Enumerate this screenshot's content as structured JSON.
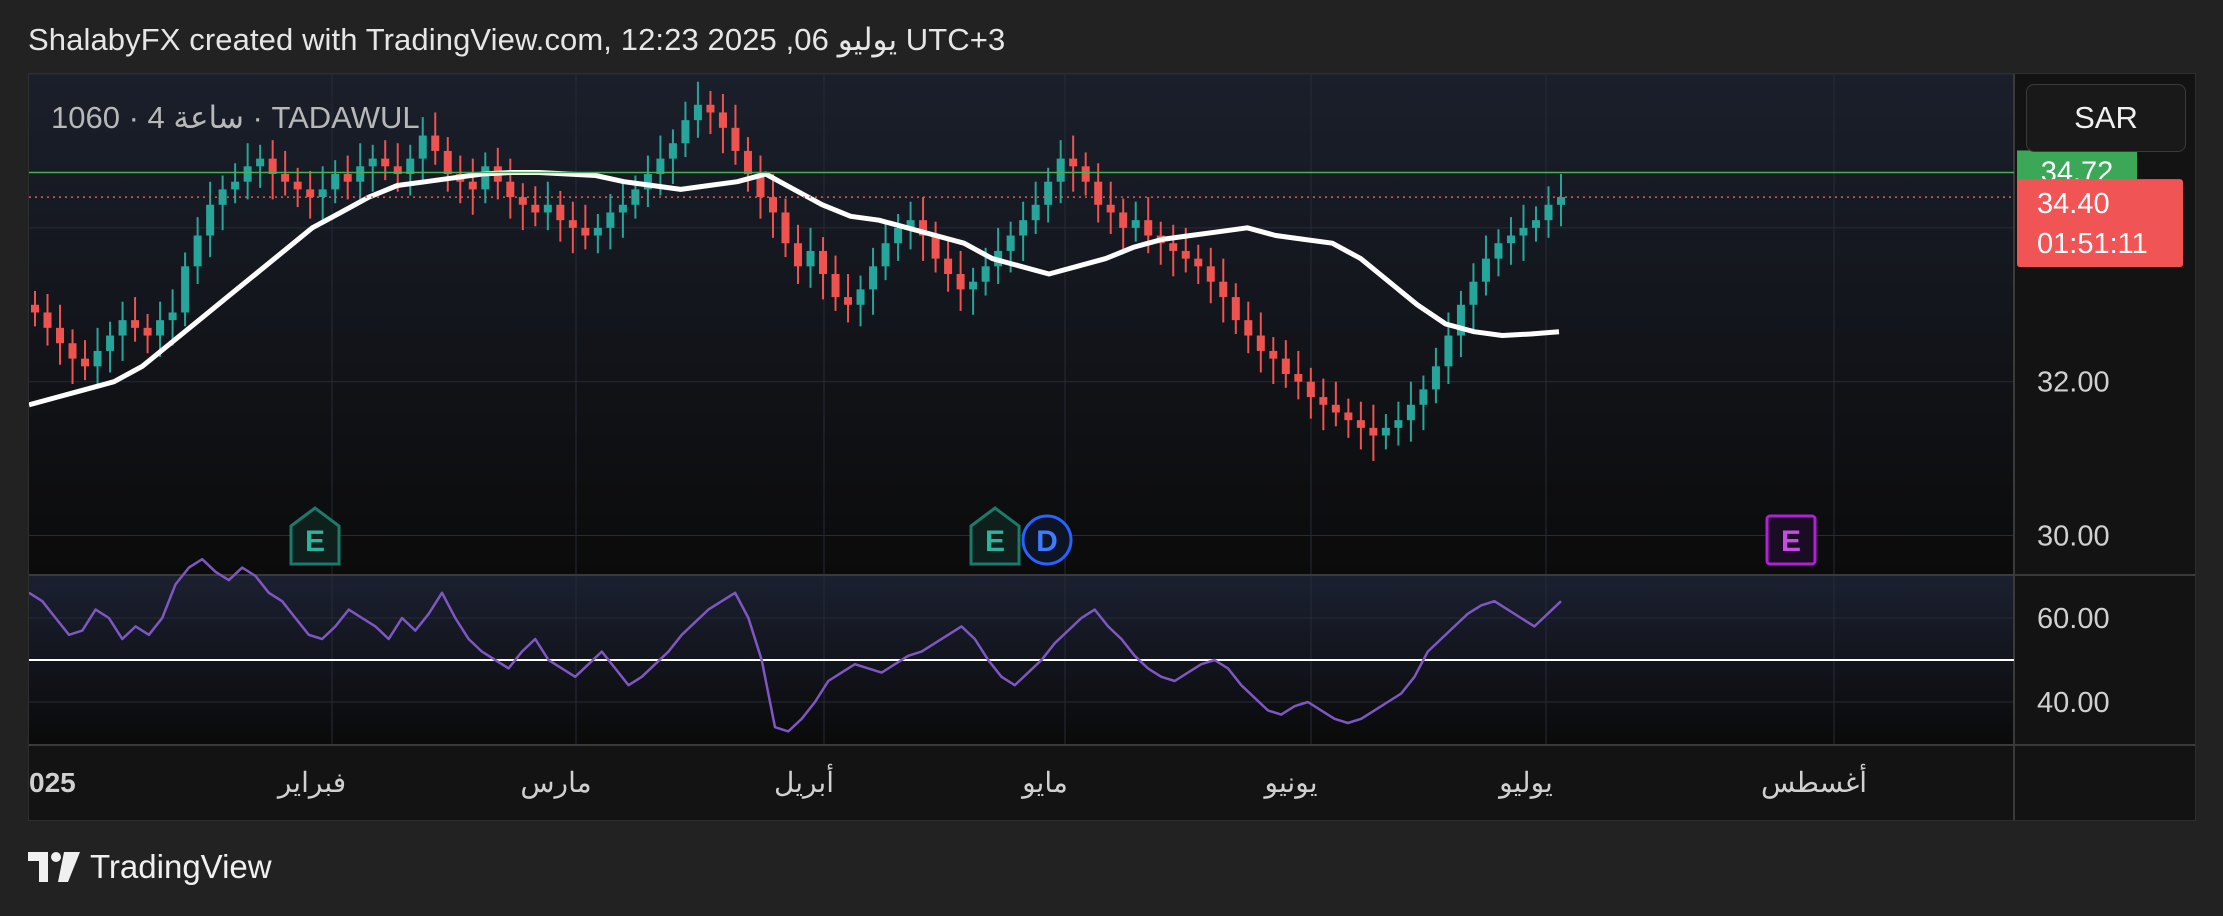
{
  "header": {
    "text": "ShalabyFX created with TradingView.com, 12:23 2025 ,06 يوليو UTC+3"
  },
  "symbol_label": "1060 · 4 ساعة · TADAWUL",
  "currency_button": "SAR",
  "brand": {
    "name": "TradingView"
  },
  "price_axis": {
    "ticks": [
      "32.00",
      "30.00"
    ],
    "high_label": "34.72",
    "last_label": "34.40",
    "countdown": "01:51:11"
  },
  "rsi_axis": {
    "ticks": [
      "60.00",
      "40.00"
    ]
  },
  "time_axis": {
    "labels": [
      "025",
      "فبراير",
      "مارس",
      "أبريل",
      "مايو",
      "يونيو",
      "يوليو",
      "أغسطس"
    ]
  },
  "events": [
    {
      "label": "E",
      "kind": "earnings-past"
    },
    {
      "label": "E",
      "kind": "earnings-past"
    },
    {
      "label": "D",
      "kind": "dividend"
    },
    {
      "label": "E",
      "kind": "earnings-upcoming"
    }
  ],
  "colors": {
    "up": "#26a69a",
    "down": "#ef5350",
    "ma": "#ffffff",
    "rsi": "#7e57c2",
    "high_line": "#4caf50",
    "last_line": "#ef5350",
    "background": "#131313",
    "earnings_past": "#1b7a6a",
    "dividend": "#2962ff",
    "earnings_upcoming": "#b31fd8"
  },
  "chart_data": [
    {
      "type": "candlestick",
      "title": "1060 · 4 ساعة · TADAWUL",
      "currency": "SAR",
      "ylim": [
        29.5,
        36.0
      ],
      "x_labels": [
        "025",
        "فبراير",
        "مارس",
        "أبريل",
        "مايو",
        "يونيو",
        "يوليو",
        "أغسطس"
      ],
      "closes": [
        32.9,
        32.7,
        32.5,
        32.3,
        32.2,
        32.4,
        32.6,
        32.8,
        32.7,
        32.6,
        32.8,
        32.9,
        33.5,
        33.9,
        34.3,
        34.5,
        34.6,
        34.8,
        34.9,
        34.7,
        34.6,
        34.5,
        34.4,
        34.5,
        34.7,
        34.6,
        34.8,
        34.9,
        34.8,
        34.7,
        34.9,
        35.2,
        35.0,
        34.7,
        34.6,
        34.5,
        34.8,
        34.6,
        34.4,
        34.3,
        34.2,
        34.3,
        34.1,
        34.0,
        33.9,
        34.0,
        34.2,
        34.3,
        34.5,
        34.7,
        34.9,
        35.1,
        35.4,
        35.6,
        35.5,
        35.3,
        35.0,
        34.7,
        34.4,
        34.2,
        33.8,
        33.5,
        33.7,
        33.4,
        33.1,
        33.0,
        33.2,
        33.5,
        33.8,
        34.0,
        34.1,
        33.9,
        33.6,
        33.4,
        33.2,
        33.3,
        33.5,
        33.7,
        33.9,
        34.1,
        34.3,
        34.6,
        34.9,
        34.8,
        34.6,
        34.3,
        34.2,
        34.0,
        34.1,
        33.9,
        33.8,
        33.7,
        33.6,
        33.5,
        33.3,
        33.1,
        32.8,
        32.6,
        32.4,
        32.3,
        32.1,
        32.0,
        31.8,
        31.7,
        31.6,
        31.5,
        31.4,
        31.3,
        31.4,
        31.5,
        31.7,
        31.9,
        32.2,
        32.6,
        33.0,
        33.3,
        33.6,
        33.8,
        33.9,
        34.0,
        34.1,
        34.3,
        34.4
      ],
      "moving_average": [
        31.7,
        31.8,
        31.9,
        32.0,
        32.2,
        32.5,
        32.8,
        33.1,
        33.4,
        33.7,
        34.0,
        34.2,
        34.4,
        34.55,
        34.6,
        34.65,
        34.7,
        34.72,
        34.72,
        34.7,
        34.68,
        34.6,
        34.55,
        34.5,
        34.55,
        34.6,
        34.7,
        34.5,
        34.3,
        34.15,
        34.1,
        34.0,
        33.9,
        33.8,
        33.6,
        33.5,
        33.4,
        33.5,
        33.6,
        33.75,
        33.85,
        33.9,
        33.95,
        34.0,
        33.9,
        33.85,
        33.8,
        33.6,
        33.3,
        33.0,
        32.75,
        32.65,
        32.6,
        32.62,
        32.65
      ],
      "high_price": 34.72,
      "last_price": 34.4
    },
    {
      "type": "line",
      "title": "RSI",
      "ylim": [
        30,
        70
      ],
      "level": 50,
      "values": [
        66,
        64,
        60,
        56,
        57,
        62,
        60,
        55,
        58,
        56,
        60,
        68,
        72,
        74,
        71,
        69,
        72,
        70,
        66,
        64,
        60,
        56,
        55,
        58,
        62,
        60,
        58,
        55,
        60,
        57,
        61,
        66,
        60,
        55,
        52,
        50,
        48,
        52,
        55,
        50,
        48,
        46,
        49,
        52,
        48,
        44,
        46,
        49,
        52,
        56,
        59,
        62,
        64,
        66,
        60,
        50,
        34,
        33,
        36,
        40,
        45,
        47,
        49,
        48,
        47,
        49,
        51,
        52,
        54,
        56,
        58,
        55,
        50,
        46,
        44,
        47,
        50,
        54,
        57,
        60,
        62,
        58,
        55,
        51,
        48,
        46,
        45,
        47,
        49,
        50,
        48,
        44,
        41,
        38,
        37,
        39,
        40,
        38,
        36,
        35,
        36,
        38,
        40,
        42,
        46,
        52,
        55,
        58,
        61,
        63,
        64,
        62,
        60,
        58,
        61,
        64
      ]
    }
  ]
}
